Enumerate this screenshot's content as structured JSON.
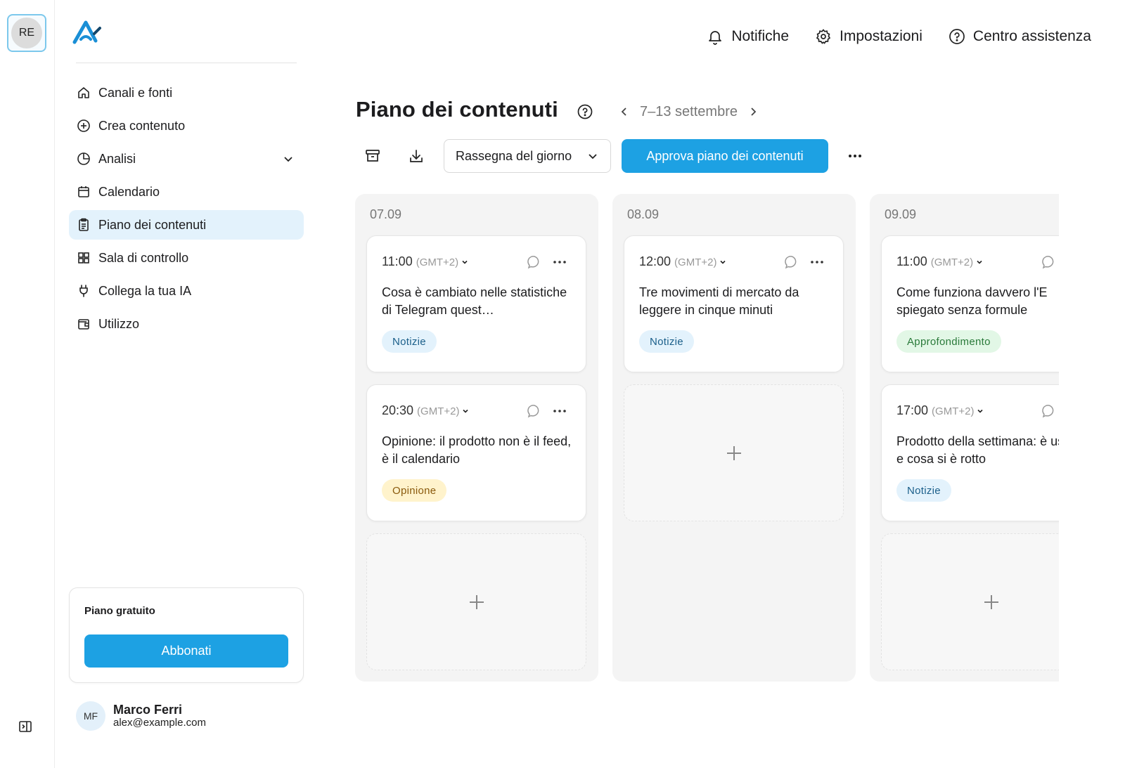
{
  "workspace": {
    "initials": "RE"
  },
  "sidebar": {
    "items": [
      {
        "label": "Canali e fonti",
        "icon": "home-icon"
      },
      {
        "label": "Crea contenuto",
        "icon": "plus-circle-icon"
      },
      {
        "label": "Analisi",
        "icon": "pie-chart-icon"
      },
      {
        "label": "Calendario",
        "icon": "calendar-icon"
      },
      {
        "label": "Piano dei contenuti",
        "icon": "clipboard-icon",
        "active": true
      },
      {
        "label": "Sala di controllo",
        "icon": "dashboard-icon"
      },
      {
        "label": "Collega la tua IA",
        "icon": "plug-icon"
      },
      {
        "label": "Utilizzo",
        "icon": "wallet-icon"
      }
    ],
    "plan": {
      "title": "Piano gratuito",
      "button": "Abbonati"
    },
    "user": {
      "initials": "MF",
      "name": "Marco Ferri",
      "email": "alex@example.com"
    }
  },
  "header": {
    "notifications": "Notifiche",
    "settings": "Impostazioni",
    "help": "Centro assistenza"
  },
  "main": {
    "title": "Piano dei contenuti",
    "week": "7–13 settembre",
    "select_value": "Rassegna del giorno",
    "approve": "Approva piano dei contenuti"
  },
  "columns": [
    {
      "date": "07.09",
      "posts": [
        {
          "time": "11:00",
          "tz": "(GMT+2)",
          "text": "Cosa è cambiato nelle statistiche di Telegram quest…",
          "tag": "Notizie"
        },
        {
          "time": "20:30",
          "tz": "(GMT+2)",
          "text": "Opinione: il prodotto non è il feed, è il calendario",
          "tag": "Opinione"
        }
      ]
    },
    {
      "date": "08.09",
      "posts": [
        {
          "time": "12:00",
          "tz": "(GMT+2)",
          "text": "Tre movimenti di mercato da leggere in cinque minuti",
          "tag": "Notizie"
        }
      ]
    },
    {
      "date": "09.09",
      "posts": [
        {
          "time": "11:00",
          "tz": "(GMT+2)",
          "text": "Come funziona davvero l'E spiegato senza formule",
          "tag": "Approfondimento"
        },
        {
          "time": "17:00",
          "tz": "(GMT+2)",
          "text": "Prodotto della settimana: è uscito e cosa si è rotto",
          "tag": "Notizie"
        }
      ]
    }
  ],
  "colors": {
    "accent": "#1da1e3",
    "active_bg": "#e3f2fc"
  }
}
